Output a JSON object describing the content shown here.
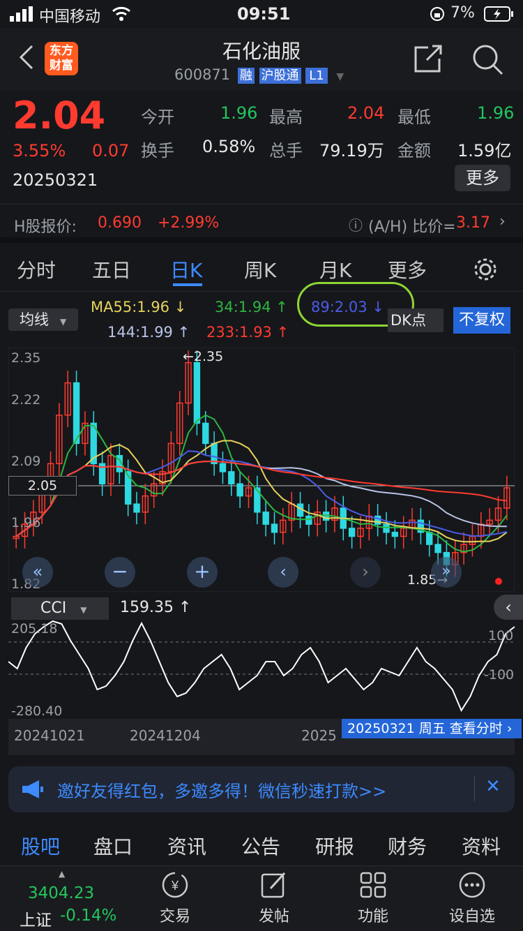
{
  "status": {
    "carrier": "中国移动",
    "time": "09:51",
    "battery": "7%"
  },
  "header": {
    "title": "石化油服",
    "code": "600871",
    "badges": [
      "融",
      "沪股通",
      "L1"
    ],
    "logo": "东方\n财富"
  },
  "quote": {
    "price": "2.04",
    "change_pct": "3.55%",
    "change": "0.07",
    "date": "20250321",
    "fields": [
      {
        "label": "今开",
        "value": "1.96",
        "color": "#22c55e"
      },
      {
        "label": "最高",
        "value": "2.04",
        "color": "#ff3b30"
      },
      {
        "label": "最低",
        "value": "1.96",
        "color": "#22c55e"
      },
      {
        "label": "换手",
        "value": "0.58%",
        "color": "#e8e8e8"
      },
      {
        "label": "总手",
        "value": "79.19万",
        "color": "#e8e8e8"
      },
      {
        "label": "金额",
        "value": "1.59亿",
        "color": "#e8e8e8"
      }
    ],
    "more_label": "更多"
  },
  "hshare": {
    "label": "H股报价:",
    "price": "0.690",
    "pct": "+2.99%",
    "ratio_label": "(A/H) 比价=",
    "ratio": "3.17"
  },
  "tabs": [
    "分时",
    "五日",
    "日K",
    "周K",
    "月K",
    "更多"
  ],
  "ma": {
    "selector": "均线",
    "ma55": "MA55:1.96 ↓",
    "ma34": "34:1.94 ↑",
    "ma89": "89:2.03 ↓",
    "ma144": "144:1.99 ↑",
    "ma233": "233:1.93 ↑",
    "dk": "DK点",
    "fq": "不复权"
  },
  "chart_data": {
    "type": "candlestick",
    "y_ticks": [
      "2.35",
      "2.22",
      "2.09",
      "1.96",
      "1.82"
    ],
    "current_label": "2.05",
    "high_label": "2.35",
    "low_label": "1.85",
    "ylim": [
      1.8,
      2.37
    ],
    "candles": [
      1.92,
      1.95,
      1.98,
      2.03,
      2.1,
      2.22,
      2.3,
      2.15,
      2.2,
      2.1,
      2.05,
      2.12,
      2.08,
      2.0,
      1.98,
      2.02,
      2.05,
      2.08,
      2.15,
      2.25,
      2.35,
      2.2,
      2.15,
      2.1,
      2.08,
      2.05,
      2.02,
      2.04,
      1.98,
      1.95,
      1.93,
      1.96,
      2.0,
      1.97,
      1.95,
      1.98,
      1.96,
      1.99,
      1.94,
      1.92,
      1.94,
      1.97,
      1.95,
      1.93,
      1.92,
      1.94,
      1.96,
      1.93,
      1.9,
      1.88,
      1.85,
      1.88,
      1.9,
      1.92,
      1.95,
      1.96,
      1.99,
      2.04
    ]
  },
  "cci": {
    "name": "CCI",
    "value": "159.35 ↑",
    "top": "205.18",
    "bottom": "-280.40",
    "pos": "100",
    "neg": "-100",
    "dates": [
      "20241021",
      "20241204",
      "2025"
    ],
    "tooltip": "20250321 周五 查看分时"
  },
  "banner": {
    "text": "邀好友得红包，多邀多得！微信秒速打款>>"
  },
  "bottom_tabs": [
    "股吧",
    "盘口",
    "资讯",
    "公告",
    "研报",
    "财务",
    "资料"
  ],
  "dock": {
    "index_value": "3404.23",
    "index_name": "上证",
    "index_pct": "-0.14%",
    "items": [
      "交易",
      "发帖",
      "功能",
      "设自选"
    ]
  }
}
